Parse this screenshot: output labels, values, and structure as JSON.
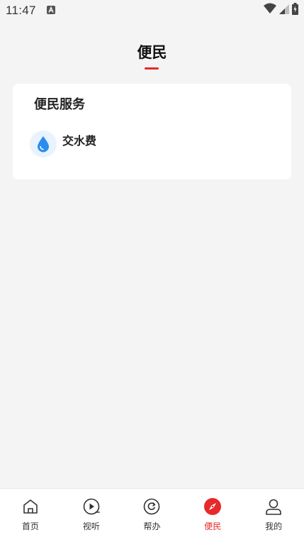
{
  "status_bar": {
    "time": "11:47",
    "notification_icon": "a-letter-icon",
    "wifi_icon": "wifi-icon",
    "signal_icon": "signal-icon",
    "battery_icon": "battery-charging-icon"
  },
  "header": {
    "title": "便民"
  },
  "services_card": {
    "title": "便民服务",
    "items": [
      {
        "label": "交水费",
        "icon": "water-drop-icon"
      }
    ]
  },
  "bottom_nav": {
    "items": [
      {
        "label": "首页",
        "icon": "home-icon"
      },
      {
        "label": "视听",
        "icon": "play-circle-icon"
      },
      {
        "label": "帮办",
        "icon": "refresh-circle-icon"
      },
      {
        "label": "便民",
        "icon": "compass-icon",
        "active": true
      },
      {
        "label": "我的",
        "icon": "user-icon"
      }
    ]
  },
  "colors": {
    "accent": "#e62a2a",
    "water_blue": "#2b8cf0",
    "background": "#f4f4f4"
  }
}
